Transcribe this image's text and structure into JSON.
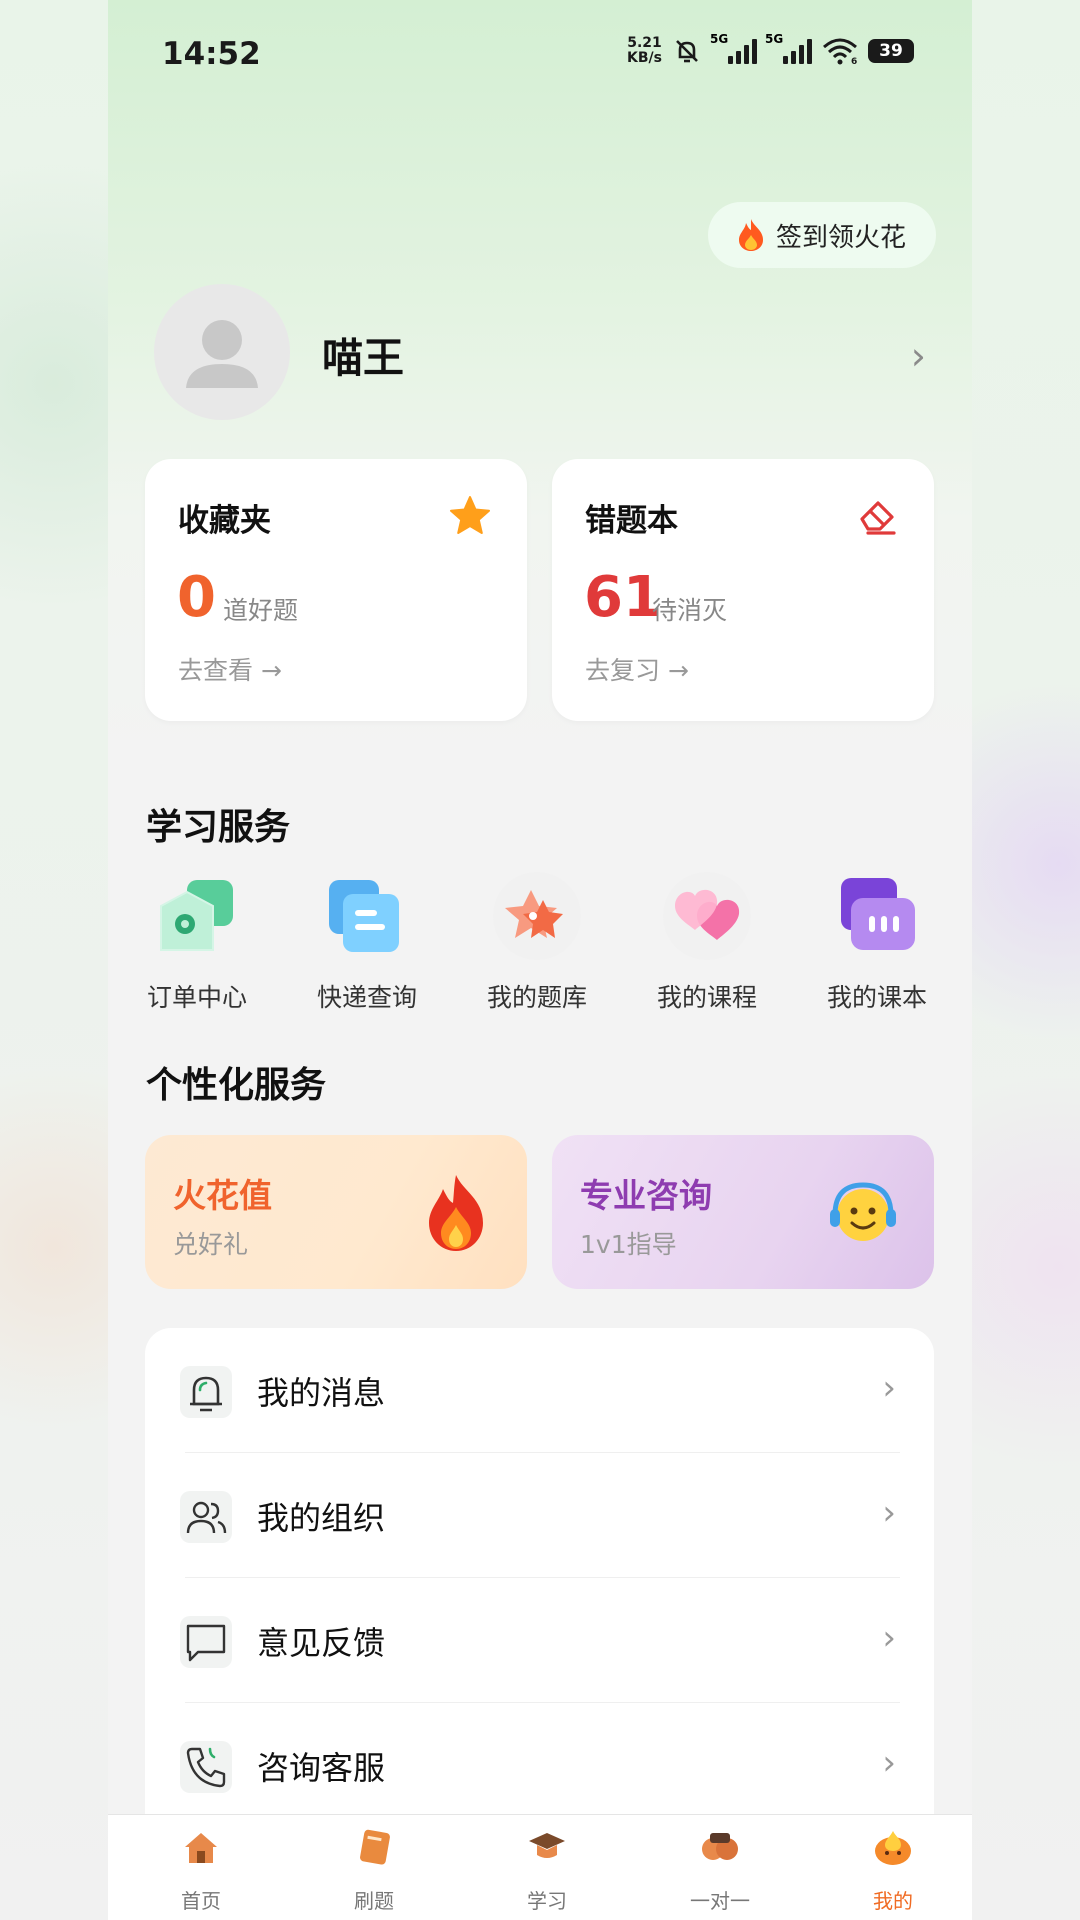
{
  "status_bar": {
    "time": "14:52",
    "net_speed_value": "5.21",
    "net_speed_unit": "KB/s",
    "signal_1_label": "5G",
    "signal_2_label": "5G",
    "wifi_label": "6",
    "battery": "39"
  },
  "header": {
    "checkin_label": "签到领火花",
    "username": "喵王"
  },
  "cards": {
    "favorites": {
      "title": "收藏夹",
      "count": "0",
      "unit": "道好题",
      "action": "去查看 →"
    },
    "wrong_book": {
      "title": "错题本",
      "count": "61",
      "unit": "待消灭",
      "action": "去复习 →"
    }
  },
  "learning_services": {
    "title": "学习服务",
    "items": [
      {
        "label": "订单中心",
        "icon": "order-icon"
      },
      {
        "label": "快递查询",
        "icon": "delivery-icon"
      },
      {
        "label": "我的题库",
        "icon": "question-bank-icon"
      },
      {
        "label": "我的课程",
        "icon": "course-icon"
      },
      {
        "label": "我的课本",
        "icon": "textbook-icon"
      }
    ]
  },
  "personal_services": {
    "title": "个性化服务",
    "spark": {
      "title": "火花值",
      "subtitle": "兑好礼"
    },
    "consult": {
      "title": "专业咨询",
      "subtitle": "1v1指导"
    }
  },
  "menu": [
    {
      "label": "我的消息",
      "icon": "bell-icon"
    },
    {
      "label": "我的组织",
      "icon": "group-icon"
    },
    {
      "label": "意见反馈",
      "icon": "feedback-icon"
    },
    {
      "label": "咨询客服",
      "icon": "phone-icon"
    }
  ],
  "tabbar": [
    {
      "label": "首页",
      "icon": "home-icon"
    },
    {
      "label": "刷题",
      "icon": "practice-icon"
    },
    {
      "label": "学习",
      "icon": "study-icon"
    },
    {
      "label": "一对一",
      "icon": "one-on-one-icon"
    },
    {
      "label": "我的",
      "icon": "profile-icon",
      "active": true
    }
  ],
  "colors": {
    "accent_orange": "#f06b23",
    "count_orange": "#f0632d",
    "count_red": "#e03a3a",
    "purple": "#8e3cb0",
    "star": "#ff9f1a"
  }
}
